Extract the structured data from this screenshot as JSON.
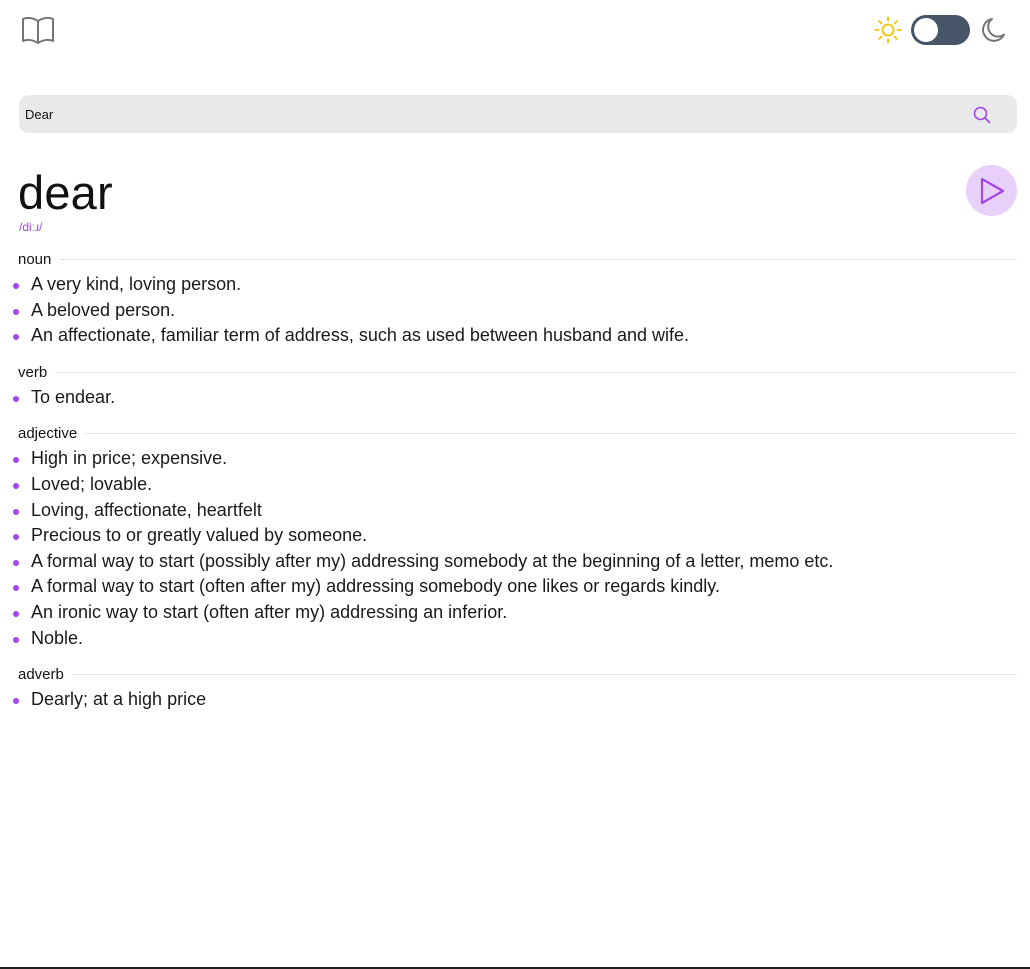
{
  "header": {
    "logo_icon": "book-icon",
    "theme": {
      "light_icon": "sun-icon",
      "dark_icon": "moon-icon",
      "accent_sun": "#f5c518",
      "toggle_color": "#475569",
      "dark_mode_enabled": false
    }
  },
  "search": {
    "value": "Dear",
    "icon": "search-icon",
    "accent": "#a445ed"
  },
  "entry": {
    "word": "dear",
    "phonetic": "/diːɹ/",
    "play_icon": "play-icon",
    "accent": "#a445ed",
    "meanings": [
      {
        "part_of_speech": "noun",
        "definitions": [
          "A very kind, loving person.",
          "A beloved person.",
          "An affectionate, familiar term of address, such as used between husband and wife."
        ]
      },
      {
        "part_of_speech": "verb",
        "definitions": [
          "To endear."
        ]
      },
      {
        "part_of_speech": "adjective",
        "definitions": [
          "High in price; expensive.",
          "Loved; lovable.",
          "Loving, affectionate, heartfelt",
          "Precious to or greatly valued by someone.",
          "A formal way to start (possibly after my) addressing somebody at the beginning of a letter, memo etc.",
          "A formal way to start (often after my) addressing somebody one likes or regards kindly.",
          "An ironic way to start (often after my) addressing an inferior.",
          "Noble."
        ]
      },
      {
        "part_of_speech": "adverb",
        "definitions": [
          "Dearly; at a high price"
        ]
      }
    ]
  }
}
